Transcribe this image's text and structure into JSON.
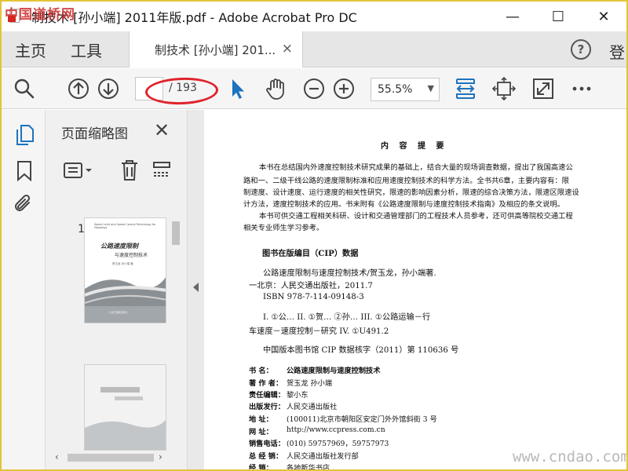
{
  "window": {
    "title": "制技术 [孙小端] 2011年版.pdf - Adobe Acrobat Pro DC",
    "minimize_glyph": "—",
    "maximize_glyph": "☐",
    "close_glyph": "✕",
    "watermark": "中国道桥网"
  },
  "tabs": {
    "home": "主页",
    "tools": "工具",
    "document_tab": "制技术 [孙小端] 201...",
    "document_tab_close": "×",
    "help": "?",
    "sign_in": "登"
  },
  "toolbar": {
    "page_input_value": "",
    "page_total": "/ 193",
    "zoom_value": "55.5%",
    "icons": [
      "search-icon",
      "page-up-icon",
      "page-down-icon",
      "select-arrow-icon",
      "hand-tool-icon",
      "zoom-out-icon",
      "zoom-in-icon",
      "fit-width-icon",
      "move-page-icon",
      "full-screen-icon",
      "more-icon"
    ],
    "accent_color": "#1e73be"
  },
  "thumbnails": {
    "panel_title": "页面缩略图",
    "close_glyph": "✕",
    "page_labels": [
      "1"
    ]
  },
  "document": {
    "heading": "内 容 提 要",
    "summary_lines": [
      "本书在总结国内外速度控制技术研究成果的基础上，结合大量的现场调查数据，提出了我国高速公",
      "路和一、二级干线公路的速度限制标准和应用速度控制技术的科学方法。全书共6章，主要内容有：限",
      "制速度、设计速度、运行速度的相关性研究，限速的影响因素分析，限速的综合决策方法，限速区限速设",
      "计方法，速度控制技术的应用。书末附有《公路速度限制与速度控制技术指南》及相应的条文说明。",
      "本书可供交通工程相关科研、设计和交通管理部门的工程技术人员参考，还可供高等院校交通工程",
      "相关专业师生学习参考。"
    ],
    "cip_title": "图书在版编目（CIP）数据",
    "cip_lines": [
      "公路速度限制与速度控制技术/贺玉龙，孙小端著.",
      "一北京：人民交通出版社，2011.7",
      "ISBN  978-7-114-09148-3",
      "I. ①公…  II. ①贺…   ②孙…   III. ①公路运输－行",
      "车速度－速度控制－研究   IV. ①U491.2",
      "中国版本图书馆 CIP 数据核字（2011）第 110636 号"
    ],
    "colophon": [
      {
        "label": "书      名：",
        "value": "公路速度限制与速度控制技术"
      },
      {
        "label": "著  作  者：",
        "value": "贺玉龙    孙小端"
      },
      {
        "label": "责任编辑：",
        "value": "黎小东"
      },
      {
        "label": "出版发行：",
        "value": "人民交通出版社"
      },
      {
        "label": "地      址：",
        "value": "(100011)北京市朝阳区安定门外外馆斜街 3 号"
      },
      {
        "label": "网      址：",
        "value": "http://www.ccpress.com.cn"
      },
      {
        "label": "销售电话：",
        "value": "(010) 59757969，59757973"
      },
      {
        "label": "总  经  销：",
        "value": "人民交通出版社发行部"
      },
      {
        "label": "经      销：",
        "value": "各地新华书店"
      }
    ],
    "watermark": "www.cndao.com"
  },
  "thumb1": {
    "title_en": "Speed Limit and Speed Control Technology for Highways",
    "title_cn": "公路速度限制",
    "subtitle_cn": "与速度控制技术",
    "authors": "贺玉龙  孙小端 著",
    "publisher": "人民交通出版社"
  }
}
